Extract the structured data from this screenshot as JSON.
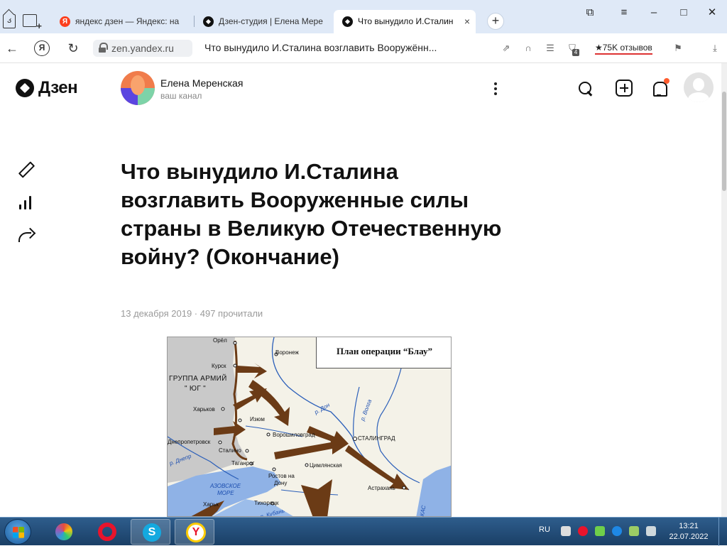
{
  "browser": {
    "tab_count": "3",
    "tabs": [
      {
        "title": "яндекс дзен — Яндекс: на"
      },
      {
        "title": "Дзен-студия | Елена Мере"
      },
      {
        "title": "Что вынудило И.Сталин"
      }
    ],
    "tab_close": "×",
    "favicon_ya": "Я",
    "new_tab": "+",
    "url": "zen.yandex.ru",
    "address_title": "Что вынудило И.Сталина возглавить Вооружённ...",
    "reviews": "★75K отзывов",
    "downloads_badge": "4"
  },
  "zen": {
    "logo": "Дзен",
    "channel_name": "Елена Меренская",
    "channel_sub": "ваш канал"
  },
  "article": {
    "title": "Что вынудило И.Сталина возглавить Вооруженные силы страны в Великую Отечественную войну? (Окончание)",
    "meta": "13 декабря 2019 · 497 прочитали"
  },
  "map": {
    "title": "План операции “Блау”",
    "group": "ГРУППА АРМИЙ",
    "group2": "\" ЮГ \"",
    "cities": {
      "orel": "Орёл",
      "voronezh": "Воронеж",
      "kursk": "Курск",
      "kharkov": "Харьков",
      "izyum": "Изюм",
      "voroshilovgrad": "Ворошиловград",
      "stalingrad": "СТАЛИНГРАД",
      "dnepropetrovsk": "Днепропетровск",
      "stalino": "Сталино",
      "taganrog": "Таганрог",
      "tsimlyanskaya": "Цимлянская",
      "rostov": "Ростов на",
      "donu": "Дону",
      "astrakhan": "Астрахань",
      "kharkh": "Харьк",
      "tikhoretsk": "Тихорецк"
    },
    "waters": {
      "don": "р. Дон",
      "volga": "р. Волга",
      "dnepr": "р. Днепр",
      "azov": "АЗОВСКОЕ",
      "more": "МОРЕ",
      "kuban": "р. Кубань",
      "kasp": "КАС"
    }
  },
  "taskbar": {
    "lang": "RU",
    "time": "13:21",
    "date": "22.07.2022",
    "skype_letter": "S",
    "yabrowser_letter": "Y"
  },
  "colors": {
    "accent_notification": "#ff5c2e",
    "tabbar_bg": "#dfe9f7",
    "taskbar_bg": "#1a3f66"
  }
}
